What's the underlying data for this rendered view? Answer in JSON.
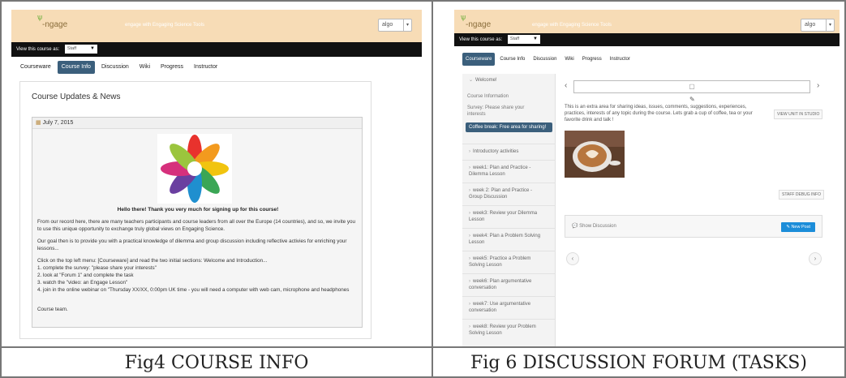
{
  "captions": {
    "left": "Fig4 COURSE INFO",
    "right": "Fig 6 DISCUSSION FORUM (TASKS)"
  },
  "colors": {
    "header": "#f7dcb6",
    "viewbar": "#111111",
    "active_tab": "#3b5f7c",
    "new_post": "#1c8dd9"
  },
  "header": {
    "logo": "ngage",
    "course_title": "engage with Engaging Science Tools",
    "user": "algo"
  },
  "viewbar": {
    "label": "View this course as:",
    "selected": "Staff"
  },
  "tabs_left": [
    "Courseware",
    "Course Info",
    "Discussion",
    "Wiki",
    "Progress",
    "Instructor"
  ],
  "tabs_right": [
    "Courseware",
    "Course Info",
    "Discussion",
    "Wiki",
    "Progress",
    "Instructor"
  ],
  "course_info": {
    "title": "Course Updates & News",
    "date": "July 7, 2015",
    "greeting": "Hello there! Thank you very much for signing up for this course!",
    "p1": "From our record here, there are many teachers participants and course leaders from all over the Europe (14 countries), and so, we invite you to use this unique opportunity to exchange truly global views on Engaging Science.",
    "p2": "Our goal then is to provide you with a practical knowledge of dilemma and group discussion including reflective activies for enriching your lessons...",
    "p3": "Click on the top left menu: [Courseware] and read the two initial sections: Welcome and Introduction...",
    "list": [
      "1. complete the survey: \"please share your interests\"",
      "2. look at \"Forum 1\" and complete the task",
      "3. watch the \"video: an Engage Lesson\"",
      "4. join in the online webinar on \"Thursday XX/XX, 0:00pm UK time - you will need a computer with web cam, microphone and headphones"
    ],
    "sign": "Course team."
  },
  "sidebar": {
    "section": "Welcome!",
    "sub1": "Course Information",
    "sub2": "Survey: Please share your interests",
    "active": "Coffee break: Free area for sharing!",
    "items": [
      "Introductory activities",
      "week1: Plan and Practice - Dilemma Lesson",
      "week 2: Plan and Practice - Group Discussion",
      "week3: Review your Dilemma Lesson",
      "week4: Plan a Problem Solving Lesson",
      "week5: Practice a Problem Solving Lesson",
      "week6: Plan argumentative conversation",
      "week7: Use argumentative conversation",
      "week8: Review your Problem Solving Lesson"
    ]
  },
  "unit": {
    "text": "This is an extra area for sharing ideas, issues, comments, suggestions, experiences, practices, interests of any topic during the course. Lets grab a cup of coffee, tea or your favorite drink and talk !",
    "studio_button": "VIEW UNIT IN STUDIO",
    "debug_button": "STAFF DEBUG INFO",
    "show_discussion": "Show Discussion",
    "new_post": "New Post"
  }
}
